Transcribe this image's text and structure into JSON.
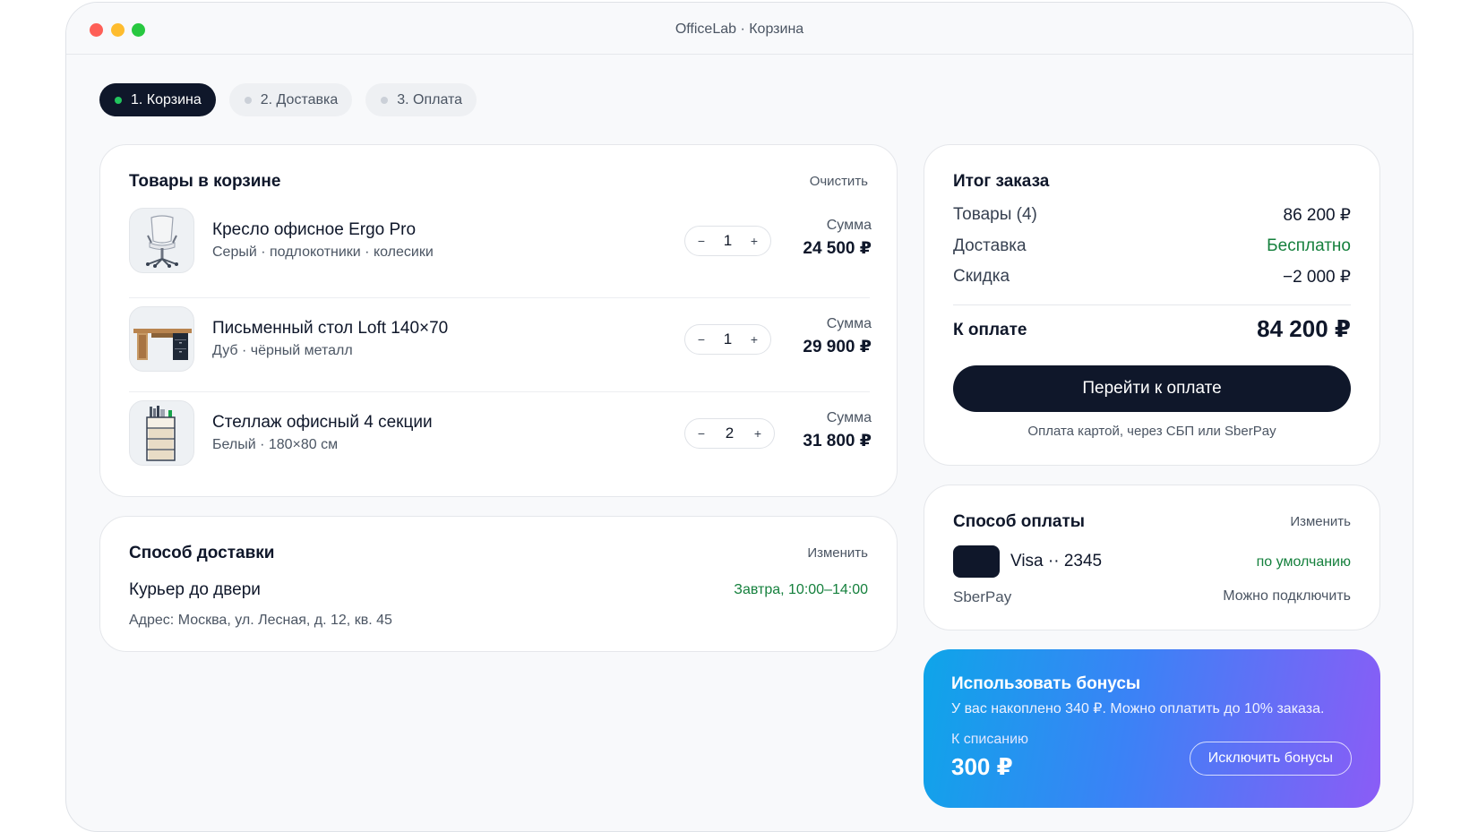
{
  "window": {
    "title": "OfficeLab · Корзина"
  },
  "steps": [
    {
      "label": "1. Корзина",
      "active": true
    },
    {
      "label": "2. Доставка",
      "active": false
    },
    {
      "label": "3. Оплата",
      "active": false
    }
  ],
  "cart": {
    "title": "Товары в корзине",
    "clear_label": "Очистить",
    "sum_label": "Сумма",
    "items": [
      {
        "name": "Кресло офисное Ergo Pro",
        "desc": "Серый · подлокотники · колесики",
        "qty": "1",
        "sum": "24 500 ₽",
        "icon": "office-chair-icon"
      },
      {
        "name": "Письменный стол Loft 140×70",
        "desc": "Дуб · чёрный металл",
        "qty": "1",
        "sum": "29 900 ₽",
        "icon": "desk-icon"
      },
      {
        "name": "Стеллаж офисный 4 секции",
        "desc": "Белый · 180×80 см",
        "qty": "2",
        "sum": "31 800 ₽",
        "icon": "shelving-icon"
      }
    ],
    "minus": "−",
    "plus": "+"
  },
  "delivery": {
    "title": "Способ доставки",
    "change_label": "Изменить",
    "method": "Курьер до двери",
    "time": "Завтра, 10:00–14:00",
    "address": "Адрес: Москва, ул. Лесная, д. 12, кв. 45"
  },
  "summary": {
    "title": "Итог заказа",
    "rows": [
      {
        "label": "Товары (4)",
        "value": "86 200 ₽"
      },
      {
        "label": "Доставка",
        "value": "Бесплатно"
      },
      {
        "label": "Скидка",
        "value": "−2 000 ₽"
      }
    ],
    "total_label": "К оплате",
    "total_value": "84 200 ₽",
    "pay_button": "Перейти к оплате",
    "pay_note": "Оплата картой, через СБП или SberPay"
  },
  "payment": {
    "title": "Способ оплаты",
    "change_label": "Изменить",
    "card": "Visa ·· 2345",
    "default_label": "по умолчанию",
    "sberpay": "SberPay",
    "connect": "Можно подключить"
  },
  "bonus": {
    "title": "Использовать бонусы",
    "subtitle": "У вас накоплено 340 ₽. Можно оплатить до 10% заказа.",
    "label": "К списанию",
    "value": "300 ₽",
    "button": "Исключить бонусы"
  },
  "colors": {
    "accent_dark": "#0f172a",
    "success": "#15803d",
    "step_dot_active": "#22c55e",
    "bonus_gradient": [
      "#0ea5e9",
      "#3b82f6",
      "#8b5cf6"
    ]
  }
}
